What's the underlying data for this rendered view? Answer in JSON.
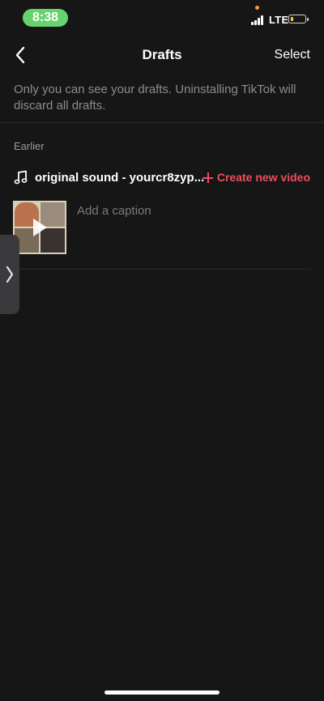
{
  "status_bar": {
    "time": "8:38",
    "network": "LTE",
    "battery_level_percent": 10,
    "colors": {
      "time_pill": "#65d46e",
      "battery_fill": "#f6d33c"
    }
  },
  "header": {
    "title": "Drafts",
    "select_label": "Select",
    "back_icon": "chevron-left-icon"
  },
  "notice": "Only you can see your drafts. Uninstalling TikTok will discard all drafts.",
  "section": {
    "label": "Earlier",
    "draft": {
      "sound_title": "original sound - yourcr8zyp...",
      "sound_icon": "music-note-icon",
      "create_label": "Create new video",
      "create_icon": "plus-icon",
      "caption_placeholder": "Add a caption",
      "thumbnail_icon": "play-icon"
    }
  },
  "accent_color": "#ee4d5f"
}
